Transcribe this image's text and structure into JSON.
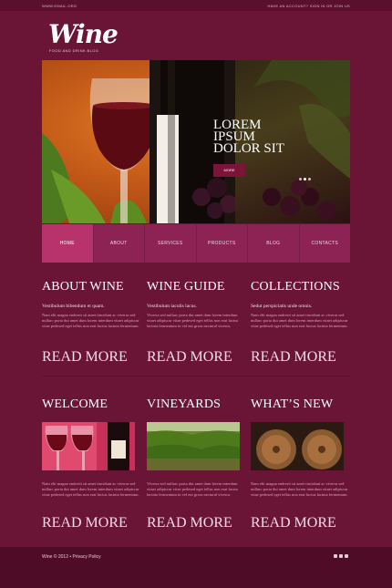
{
  "topbar": {
    "left": "WWW.EMAIL.ORG",
    "right": "HAVE AN ACCOUNT? SIGN IN OR JOIN US"
  },
  "logo": {
    "text": "Wine",
    "tagline": "FOOD AND DRINK BLOG"
  },
  "slider": {
    "title": "LOREM IPSUM DOLOR SIT",
    "button": "MORE",
    "dots": 3,
    "active_dot": 1
  },
  "nav": {
    "items": [
      "HOME",
      "ABOUT",
      "SERVICES",
      "PRODUCTS",
      "BLOG",
      "CONTACTS"
    ],
    "active_index": 0
  },
  "sections_top": [
    {
      "title": "ABOUT WINE",
      "lead": "Vestibulum bibendum et quam.",
      "body": "Nam elit magna endrerit sit amet tincidunt ac viverra sed nullarc porta dui amet dum lorem interdum vitaet adipiscur vitae pedesed eget tellus non erat luctus lacinia fermentum.",
      "read_more": "READ MORE"
    },
    {
      "title": "WINE GUIDE",
      "lead": "Vestibulum iaculis lacus.",
      "body": "Viverra sed nullarc porta dui amet dum lorem interdum vitaet adipiscur vitae pedesed eget tellus non erat luctus lacinia fermentum in vel ent gross nectural viverra.",
      "read_more": "READ MORE"
    },
    {
      "title": "COLLECTIONS",
      "lead": "Sedut perspiciatis unde omnis.",
      "body": "Nam elit magna endrerit sit amet tincidunt ac viverra sed nullarc porta dui amet dum lorem interdum vitaet adipiscur vitae pedesed eget tellus non erat luctus lacinia fermentum.",
      "read_more": "READ MORE"
    }
  ],
  "sections_bottom": [
    {
      "title": "WELCOME",
      "body": "Nam elit magna endrerit sit amet tincidunt ac viverra sed nullarc porta dui amet dum lorem interdum vitaet adipiscur vitae pedesed eget tellus non erat luctus lacinia fermentum.",
      "read_more": "READ MORE"
    },
    {
      "title": "VINEYARDS",
      "body": "Viverra sed nullarc porta dui amet dum lorem interdum vitaet adipiscur vitae pedesed eget tellus non erat luctus lacinia fermentum in vel ent gross nectural viverra.",
      "read_more": "READ MORE"
    },
    {
      "title": "WHAT’S NEW",
      "body": "Nam elit magna endrerit sit amet tincidunt ac viverra sed nullarc porta dui amet dum lorem interdum vitaet adipiscur vitae pedesed eget tellus non erat luctus lacinia fermentum.",
      "read_more": "READ MORE"
    }
  ],
  "footer": {
    "copyright": "Wine © 2012 • Privacy Policy"
  },
  "colors": {
    "background": "#6a1436",
    "nav": "#8c2354",
    "nav_active": "#b8326c",
    "footer": "#4e0c27",
    "button": "#7a1438"
  }
}
